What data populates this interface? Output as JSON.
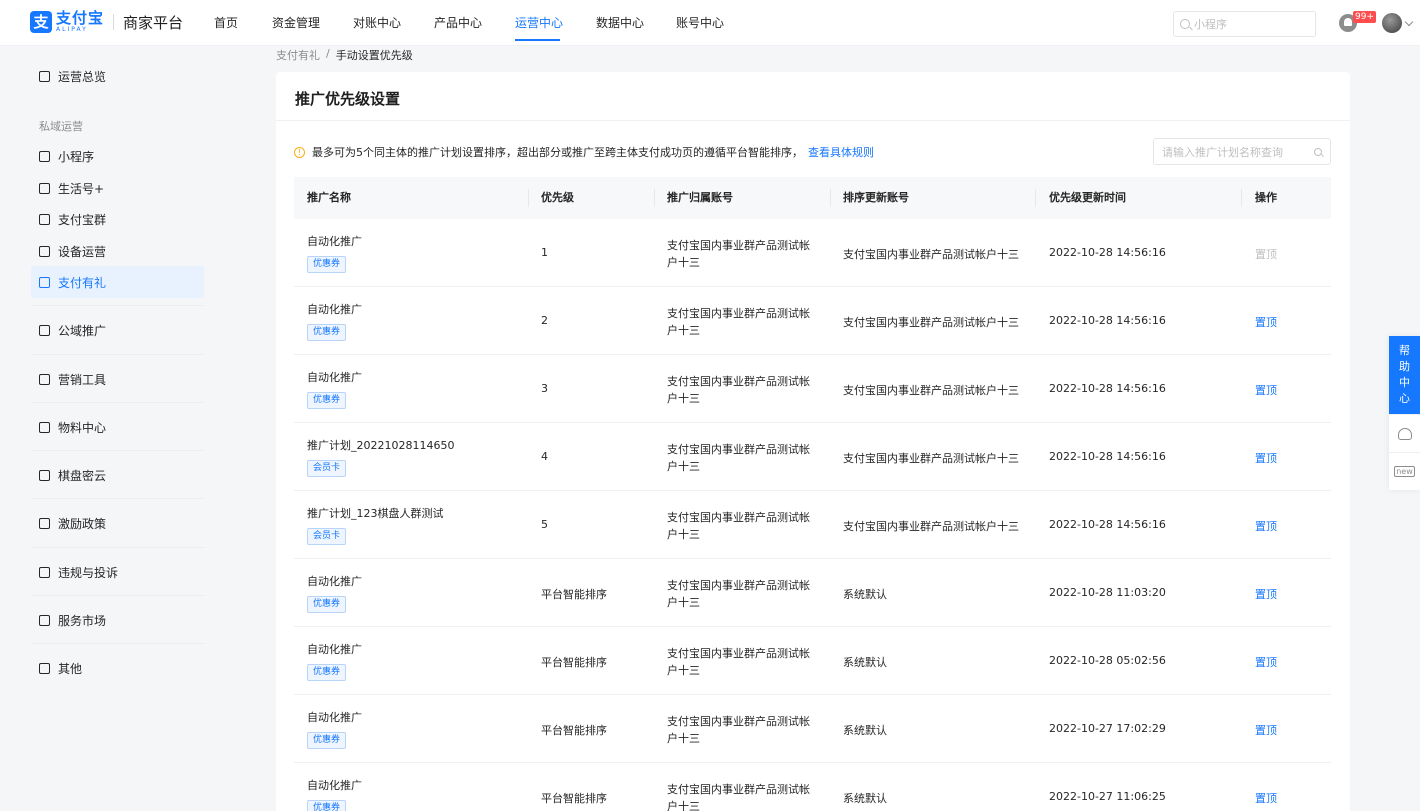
{
  "brand": {
    "cn": "支付宝",
    "en": "ALIPAY",
    "platform": "商家平台",
    "mark": "支"
  },
  "nav": [
    {
      "label": "首页",
      "active": false
    },
    {
      "label": "资金管理",
      "active": false
    },
    {
      "label": "对账中心",
      "active": false
    },
    {
      "label": "产品中心",
      "active": false
    },
    {
      "label": "运营中心",
      "active": true
    },
    {
      "label": "数据中心",
      "active": false
    },
    {
      "label": "账号中心",
      "active": false
    }
  ],
  "top_search": {
    "placeholder": "小程序"
  },
  "notifications": {
    "badge": "99+"
  },
  "sidebar": {
    "overview": "运营总览",
    "group_private": "私域运营",
    "items": [
      {
        "label": "小程序",
        "icon": "cube-icon"
      },
      {
        "label": "生活号+",
        "icon": "profile-icon"
      },
      {
        "label": "支付宝群",
        "icon": "group-icon"
      },
      {
        "label": "设备运营",
        "icon": "device-icon"
      },
      {
        "label": "支付有礼",
        "icon": "gift-icon",
        "active": true
      }
    ],
    "sections": [
      {
        "label": "公域推广",
        "icon": "promo-icon"
      },
      {
        "label": "营销工具",
        "icon": "tools-icon"
      },
      {
        "label": "物料中心",
        "icon": "material-icon"
      },
      {
        "label": "棋盘密云",
        "icon": "cloud-icon"
      },
      {
        "label": "激励政策",
        "icon": "target-icon"
      },
      {
        "label": "违规与投诉",
        "icon": "complaint-icon"
      },
      {
        "label": "服务市场",
        "icon": "market-icon"
      },
      {
        "label": "其他",
        "icon": "other-icon"
      }
    ]
  },
  "breadcrumb": {
    "parent": "支付有礼",
    "separator": "/",
    "current": "手动设置优先级"
  },
  "page": {
    "title": "推广优先级设置",
    "notice": "最多可为5个同主体的推广计划设置排序，超出部分或推广至跨主体支付成功页的遵循平台智能排序，",
    "notice_link": "查看具体规则",
    "search_placeholder": "请输入推广计划名称查询"
  },
  "table": {
    "headers": {
      "name": "推广名称",
      "priority": "优先级",
      "owner": "推广归属账号",
      "updater": "排序更新账号",
      "time": "优先级更新时间",
      "op": "操作"
    },
    "rows": [
      {
        "name": "自动化推广",
        "tag": "优惠券",
        "priority": "1",
        "owner": "支付宝国内事业群产品测试帐户十三",
        "updater": "支付宝国内事业群产品测试帐户十三",
        "time": "2022-10-28 14:56:16",
        "op": "置顶",
        "op_disabled": true
      },
      {
        "name": "自动化推广",
        "tag": "优惠券",
        "priority": "2",
        "owner": "支付宝国内事业群产品测试帐户十三",
        "updater": "支付宝国内事业群产品测试帐户十三",
        "time": "2022-10-28 14:56:16",
        "op": "置顶",
        "op_disabled": false
      },
      {
        "name": "自动化推广",
        "tag": "优惠券",
        "priority": "3",
        "owner": "支付宝国内事业群产品测试帐户十三",
        "updater": "支付宝国内事业群产品测试帐户十三",
        "time": "2022-10-28 14:56:16",
        "op": "置顶",
        "op_disabled": false
      },
      {
        "name": "推广计划_20221028114650",
        "tag": "会员卡",
        "priority": "4",
        "owner": "支付宝国内事业群产品测试帐户十三",
        "updater": "支付宝国内事业群产品测试帐户十三",
        "time": "2022-10-28 14:56:16",
        "op": "置顶",
        "op_disabled": false
      },
      {
        "name": "推广计划_123棋盘人群测试",
        "tag": "会员卡",
        "priority": "5",
        "owner": "支付宝国内事业群产品测试帐户十三",
        "updater": "支付宝国内事业群产品测试帐户十三",
        "time": "2022-10-28 14:56:16",
        "op": "置顶",
        "op_disabled": false
      },
      {
        "name": "自动化推广",
        "tag": "优惠券",
        "priority": "平台智能排序",
        "owner": "支付宝国内事业群产品测试帐户十三",
        "updater": "系统默认",
        "time": "2022-10-28 11:03:20",
        "op": "置顶",
        "op_disabled": false
      },
      {
        "name": "自动化推广",
        "tag": "优惠券",
        "priority": "平台智能排序",
        "owner": "支付宝国内事业群产品测试帐户十三",
        "updater": "系统默认",
        "time": "2022-10-28 05:02:56",
        "op": "置顶",
        "op_disabled": false
      },
      {
        "name": "自动化推广",
        "tag": "优惠券",
        "priority": "平台智能排序",
        "owner": "支付宝国内事业群产品测试帐户十三",
        "updater": "系统默认",
        "time": "2022-10-27 17:02:29",
        "op": "置顶",
        "op_disabled": false
      },
      {
        "name": "自动化推广",
        "tag": "优惠券",
        "priority": "平台智能排序",
        "owner": "支付宝国内事业群产品测试帐户十三",
        "updater": "系统默认",
        "time": "2022-10-27 11:06:25",
        "op": "置顶",
        "op_disabled": false
      }
    ]
  },
  "help": {
    "chars": [
      "帮",
      "助",
      "中",
      "心"
    ],
    "new_label": "new"
  }
}
